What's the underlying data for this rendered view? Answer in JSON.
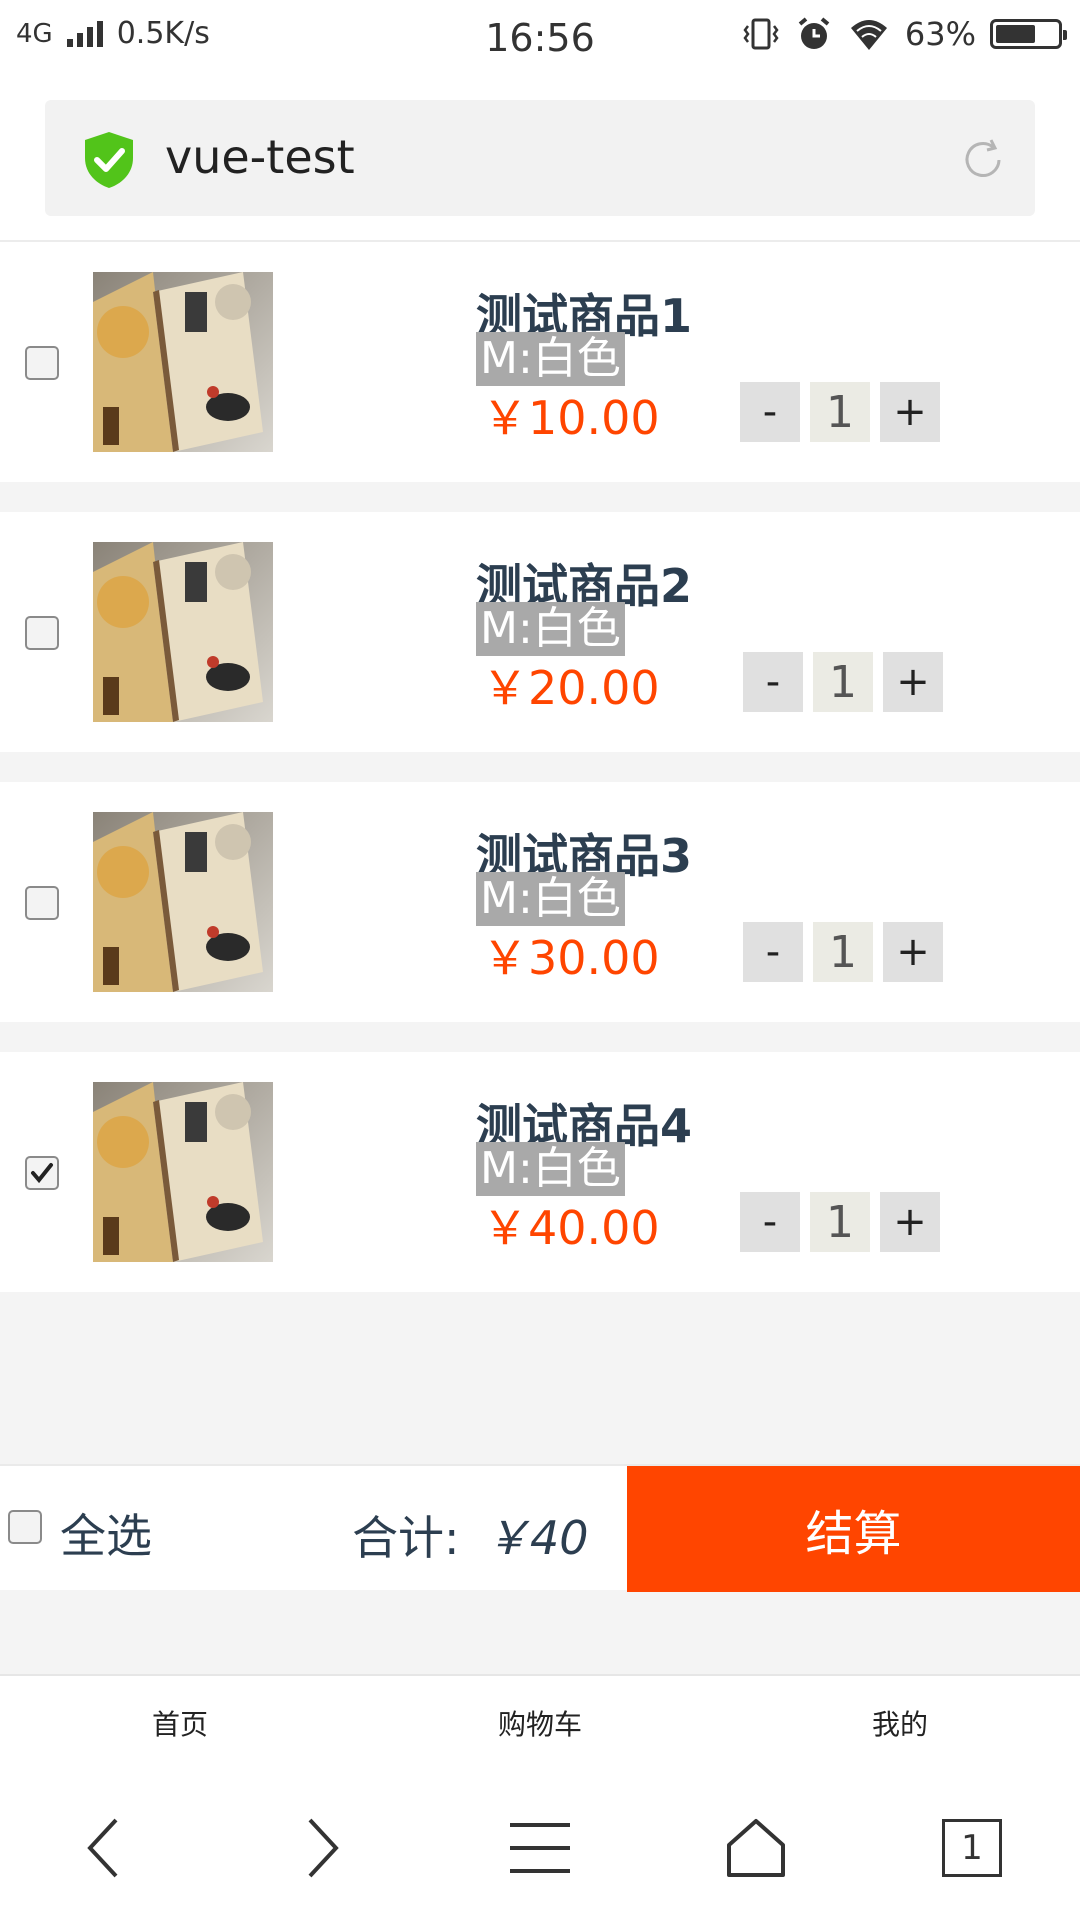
{
  "status_bar": {
    "network": "4G",
    "speed": "0.5K/s",
    "time": "16:56",
    "battery": "63%",
    "battery_level": 0.63
  },
  "address_bar": {
    "title": "vue-test",
    "secure_icon": "shield-check-icon",
    "reload_icon": "reload-icon"
  },
  "cart": {
    "items": [
      {
        "name": "测试商品1",
        "spec": "M:白色",
        "price": "￥10.00",
        "quantity": "1",
        "checked": false
      },
      {
        "name": "测试商品2",
        "spec": "M:白色",
        "price": "￥20.00",
        "quantity": "1",
        "checked": false
      },
      {
        "name": "测试商品3",
        "spec": "M:白色",
        "price": "￥30.00",
        "quantity": "1",
        "checked": false
      },
      {
        "name": "测试商品4",
        "spec": "M:白色",
        "price": "￥40.00",
        "quantity": "1",
        "checked": true
      }
    ],
    "minus_label": "-",
    "plus_label": "+"
  },
  "checkout": {
    "select_all_label": "全选",
    "select_all_checked": false,
    "total_label": "合计:",
    "total_value": "￥40",
    "button_label": "结算"
  },
  "bottom_nav": {
    "items": [
      "首页",
      "购物车",
      "我的"
    ]
  },
  "browser_toolbar": {
    "tab_count": "1",
    "icons": [
      "back-icon",
      "forward-icon",
      "menu-icon",
      "home-icon",
      "tabs-icon"
    ]
  },
  "colors": {
    "accent": "#ff4500",
    "text": "#2c3e50",
    "spec_bg": "#a9a9a9",
    "background": "#f4f4f4"
  }
}
